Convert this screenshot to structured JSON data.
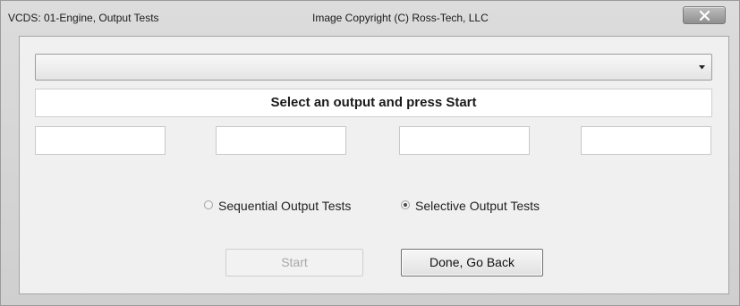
{
  "window": {
    "title": "VCDS: 01-Engine,  Output Tests",
    "copyright": "Image Copyright (C) Ross-Tech, LLC",
    "close_icon": "close-x-icon"
  },
  "output_select": {
    "value": "",
    "arrow_icon": "chevron-down-icon"
  },
  "status_message": "Select an output and press Start",
  "readouts": [
    "",
    "",
    "",
    ""
  ],
  "test_mode": {
    "sequential_label": "Sequential Output Tests",
    "selective_label": "Selective Output Tests",
    "selected": "selective"
  },
  "buttons": {
    "start_label": "Start",
    "start_enabled": false,
    "done_label": "Done, Go Back"
  }
}
